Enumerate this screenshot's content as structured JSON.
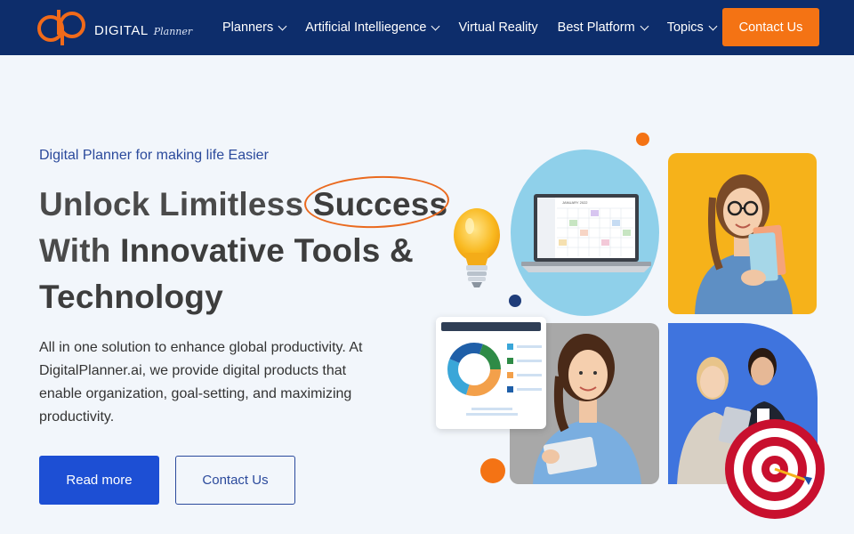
{
  "brand": {
    "name": "DIGITAL",
    "script": "Planner",
    "colors": {
      "navy": "#0d2d6b",
      "orange": "#f47314",
      "blue": "#1d4fd4"
    }
  },
  "nav": {
    "items": [
      {
        "label": "Planners",
        "has_dropdown": true
      },
      {
        "label": "Artificial Intelliegence",
        "has_dropdown": true
      },
      {
        "label": "Virtual Reality",
        "has_dropdown": false
      },
      {
        "label": "Best Platform",
        "has_dropdown": true
      },
      {
        "label": "Topics",
        "has_dropdown": true
      }
    ],
    "contact_label": "Contact Us"
  },
  "hero": {
    "tagline": "Digital Planner for making life Easier",
    "headline": {
      "line1_plain": "Unlock Limitless ",
      "line1_bold": "Success",
      "line2_plain": "With ",
      "line2_bold": "Innovative Tools &",
      "line3_bold": "Technology"
    },
    "description": "All in one solution to enhance global productivity. At DigitalPlanner.ai, we provide digital products that enable organization, goal-setting, and maximizing productivity.",
    "primary_button": "Read more",
    "secondary_button": "Contact Us"
  },
  "illustration": {
    "calendar_title": "JANUARY 2022",
    "icons": [
      "lightbulb-icon",
      "laptop-calendar",
      "donut-chart-card",
      "target-icon"
    ]
  }
}
